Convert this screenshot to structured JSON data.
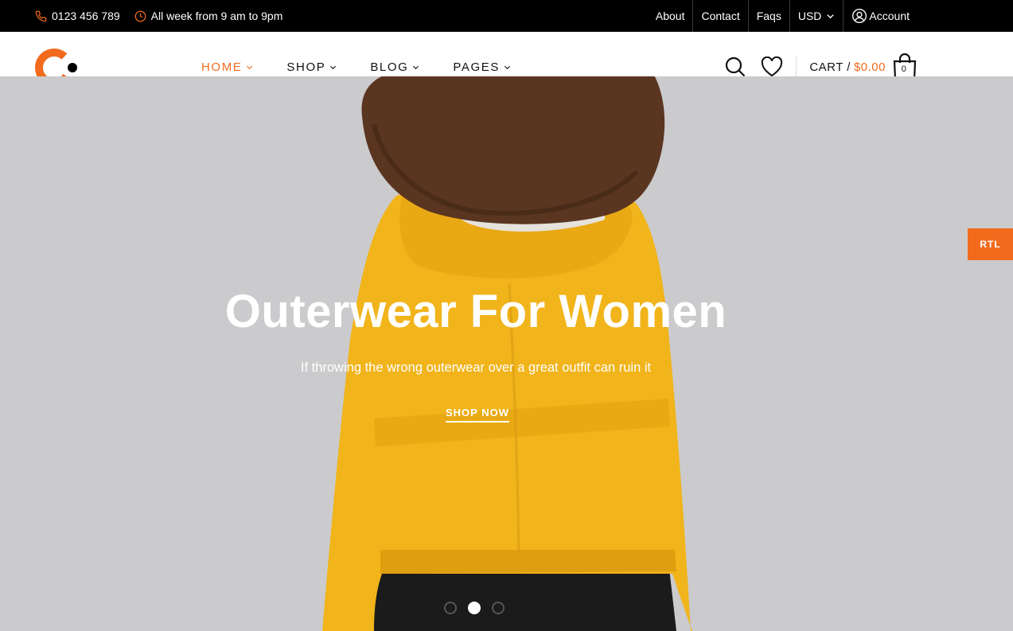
{
  "colors": {
    "accent": "#f26b1d",
    "topbar_bg": "#000000",
    "hero_bg": "#cbcbcd",
    "jacket": "#f1b41b"
  },
  "topbar": {
    "phone": {
      "icon": "phone-icon",
      "text": "0123 456 789"
    },
    "hours": {
      "icon": "clock-icon",
      "text": "All week from 9 am to 9pm"
    },
    "links": {
      "about": "About",
      "contact": "Contact",
      "faqs": "Faqs",
      "currency": "USD",
      "account": "Account"
    }
  },
  "header": {
    "logo": "logo-icon",
    "nav": [
      {
        "label": "HOME"
      },
      {
        "label": "SHOP"
      },
      {
        "label": "BLOG"
      },
      {
        "label": "PAGES"
      }
    ],
    "cart": {
      "label": "CART /",
      "price": "$0.00",
      "count": "0"
    }
  },
  "hero": {
    "title": "Outerwear For Women",
    "subtitle": "If throwing the wrong outerwear over a great outfit can ruin it",
    "button": "SHOP NOW",
    "slide_count": 3,
    "active_slide": 2
  },
  "rtl_button": "RTL"
}
